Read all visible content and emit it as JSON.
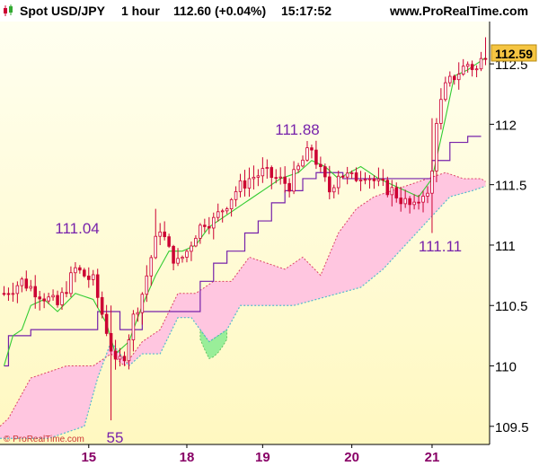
{
  "header": {
    "instrument": "Spot USD/JPY",
    "timeframe": "1 hour",
    "price_change": "112.60 (+0.04%)",
    "time": "15:17:52",
    "site": "www.ProRealTime.com"
  },
  "watermark": "© ProRealTime.com",
  "annotations": {
    "low_left": "111.04",
    "high_mid": "111.88",
    "low_right": "111.11",
    "low_bottom": "55"
  },
  "colors": {
    "background_top": "#fffff0",
    "background_bottom": "#fff8c0",
    "candle": "#cc0033",
    "tenkan": "#33cc33",
    "kijun": "#7722aa",
    "cloud_bear": "#ffc6e0",
    "cloud_bull": "#99ee99",
    "cloud_edge": "#55bbcc",
    "annotation": "#7722aa",
    "axis_label_x": "#880066",
    "last_price_box": "#f5c542"
  },
  "chart_data": {
    "type": "candlestick-ichimoku",
    "instrument": "Spot USD/JPY",
    "interval": "1 hour",
    "last_price": "112.59",
    "ylim": [
      109.35,
      112.85
    ],
    "y_ticks": [
      {
        "value": 109.5,
        "label": "109.5"
      },
      {
        "value": 110,
        "label": "110"
      },
      {
        "value": 110.5,
        "label": "110.5"
      },
      {
        "value": 111,
        "label": "111"
      },
      {
        "value": 111.5,
        "label": "111.5"
      },
      {
        "value": 112,
        "label": "112"
      },
      {
        "value": 112.5,
        "label": "112.5"
      }
    ],
    "x_ticks": [
      {
        "label": "15",
        "index": 19
      },
      {
        "label": "18",
        "index": 41
      },
      {
        "label": "19",
        "index": 58
      },
      {
        "label": "20",
        "index": 78
      },
      {
        "label": "21",
        "index": 96
      }
    ],
    "n_bars": 109,
    "price_path": [
      [
        0,
        110.6
      ],
      [
        4,
        110.7
      ],
      [
        8,
        110.6
      ],
      [
        12,
        110.5
      ],
      [
        16,
        110.8
      ],
      [
        20,
        110.7
      ],
      [
        23,
        110.3
      ],
      [
        25,
        110.0
      ],
      [
        27,
        110.1
      ],
      [
        29,
        110.4
      ],
      [
        31,
        110.6
      ],
      [
        33,
        110.9
      ],
      [
        35,
        111.15
      ],
      [
        37,
        110.95
      ],
      [
        39,
        110.85
      ],
      [
        41,
        110.95
      ],
      [
        43,
        111.1
      ],
      [
        45,
        111.2
      ],
      [
        47,
        111.2
      ],
      [
        49,
        111.3
      ],
      [
        52,
        111.45
      ],
      [
        55,
        111.55
      ],
      [
        58,
        111.6
      ],
      [
        61,
        111.55
      ],
      [
        64,
        111.5
      ],
      [
        67,
        111.7
      ],
      [
        69,
        111.8
      ],
      [
        71,
        111.6
      ],
      [
        73,
        111.45
      ],
      [
        75,
        111.6
      ],
      [
        78,
        111.55
      ],
      [
        81,
        111.6
      ],
      [
        84,
        111.5
      ],
      [
        87,
        111.45
      ],
      [
        90,
        111.35
      ],
      [
        92,
        111.3
      ],
      [
        94,
        111.45
      ],
      [
        95,
        111.4
      ],
      [
        96,
        111.6
      ],
      [
        97,
        112.05
      ],
      [
        99,
        112.3
      ],
      [
        101,
        112.4
      ],
      [
        104,
        112.5
      ],
      [
        106,
        112.45
      ],
      [
        108,
        112.6
      ]
    ],
    "tenkan_path": [
      [
        0,
        110.0
      ],
      [
        2,
        110.25
      ],
      [
        4,
        110.3
      ],
      [
        6,
        110.5
      ],
      [
        9,
        110.55
      ],
      [
        12,
        110.45
      ],
      [
        16,
        110.6
      ],
      [
        20,
        110.55
      ],
      [
        23,
        110.35
      ],
      [
        25,
        110.1
      ],
      [
        28,
        110.2
      ],
      [
        31,
        110.5
      ],
      [
        34,
        110.75
      ],
      [
        37,
        110.95
      ],
      [
        40,
        110.95
      ],
      [
        43,
        111.0
      ],
      [
        46,
        111.15
      ],
      [
        50,
        111.25
      ],
      [
        54,
        111.35
      ],
      [
        58,
        111.45
      ],
      [
        62,
        111.55
      ],
      [
        66,
        111.6
      ],
      [
        69,
        111.7
      ],
      [
        72,
        111.65
      ],
      [
        75,
        111.55
      ],
      [
        80,
        111.65
      ],
      [
        84,
        111.55
      ],
      [
        87,
        111.5
      ],
      [
        90,
        111.45
      ],
      [
        93,
        111.4
      ],
      [
        96,
        111.55
      ],
      [
        99,
        112.05
      ],
      [
        101,
        112.4
      ],
      [
        104,
        112.45
      ],
      [
        108,
        112.55
      ]
    ],
    "kijun_path": [
      [
        0,
        110.0
      ],
      [
        1,
        110.25
      ],
      [
        6,
        110.3
      ],
      [
        11,
        110.3
      ],
      [
        20,
        110.3
      ],
      [
        21,
        110.45
      ],
      [
        25,
        110.45
      ],
      [
        26,
        110.3
      ],
      [
        30,
        110.3
      ],
      [
        31,
        110.45
      ],
      [
        40,
        110.45
      ],
      [
        42,
        110.45
      ],
      [
        44,
        110.7
      ],
      [
        47,
        110.85
      ],
      [
        50,
        110.95
      ],
      [
        54,
        111.1
      ],
      [
        57,
        111.2
      ],
      [
        60,
        111.35
      ],
      [
        63,
        111.45
      ],
      [
        67,
        111.55
      ],
      [
        70,
        111.6
      ],
      [
        76,
        111.55
      ],
      [
        82,
        111.55
      ],
      [
        92,
        111.55
      ],
      [
        96,
        111.7
      ],
      [
        100,
        111.85
      ],
      [
        104,
        111.9
      ],
      [
        107,
        111.9
      ]
    ],
    "cloud_top_path": [
      [
        0,
        109.5
      ],
      [
        6,
        109.9
      ],
      [
        10,
        109.95
      ],
      [
        14,
        110.0
      ],
      [
        20,
        110.0
      ],
      [
        24,
        110.1
      ],
      [
        27,
        110.0
      ],
      [
        31,
        110.2
      ],
      [
        35,
        110.3
      ],
      [
        39,
        110.6
      ],
      [
        43,
        110.6
      ],
      [
        47,
        110.7
      ],
      [
        51,
        110.7
      ],
      [
        55,
        110.9
      ],
      [
        59,
        110.85
      ],
      [
        63,
        110.8
      ],
      [
        67,
        110.9
      ],
      [
        71,
        110.75
      ],
      [
        75,
        111.1
      ],
      [
        79,
        111.3
      ],
      [
        83,
        111.4
      ],
      [
        87,
        111.45
      ],
      [
        91,
        111.5
      ],
      [
        95,
        111.55
      ],
      [
        99,
        111.6
      ],
      [
        103,
        111.55
      ],
      [
        107,
        111.55
      ],
      [
        109,
        111.5
      ]
    ],
    "cloud_bottom_path": [
      [
        0,
        109.4
      ],
      [
        6,
        109.4
      ],
      [
        10,
        109.4
      ],
      [
        14,
        109.45
      ],
      [
        18,
        109.5
      ],
      [
        21,
        109.9
      ],
      [
        24,
        110.2
      ],
      [
        28,
        110.0
      ],
      [
        31,
        110.1
      ],
      [
        35,
        110.1
      ],
      [
        39,
        110.4
      ],
      [
        42,
        110.4
      ],
      [
        44,
        110.3
      ],
      [
        46,
        110.2
      ],
      [
        50,
        110.3
      ],
      [
        53,
        110.5
      ],
      [
        56,
        110.5
      ],
      [
        60,
        110.5
      ],
      [
        65,
        110.5
      ],
      [
        70,
        110.55
      ],
      [
        75,
        110.6
      ],
      [
        80,
        110.65
      ],
      [
        85,
        110.8
      ],
      [
        90,
        111.0
      ],
      [
        95,
        111.2
      ],
      [
        100,
        111.4
      ],
      [
        105,
        111.45
      ],
      [
        109,
        111.5
      ]
    ],
    "bull_twist": {
      "from": 44,
      "to": 50
    },
    "spikes": [
      {
        "index": 24,
        "low": 109.55,
        "high": 110.5
      },
      {
        "index": 34,
        "high": 111.3
      },
      {
        "index": 96,
        "low": 111.1,
        "high": 112.05
      },
      {
        "index": 108,
        "high": 112.72
      }
    ]
  }
}
